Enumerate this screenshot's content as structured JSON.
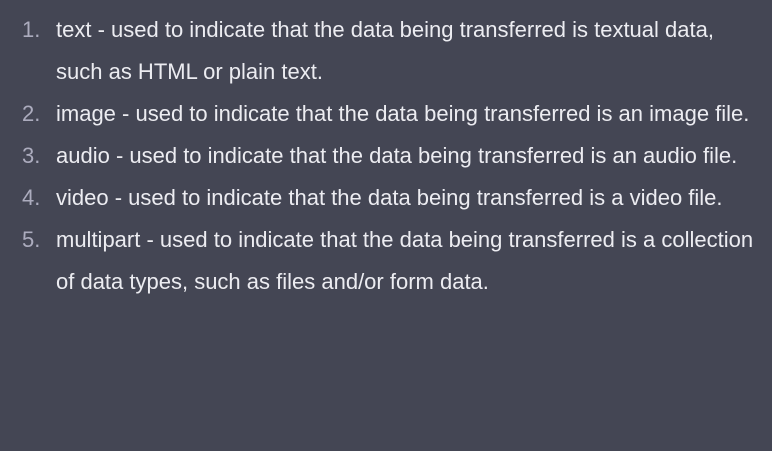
{
  "list": {
    "items": [
      {
        "number": "1.",
        "text": "text - used to indicate that the data being transferred is textual data, such as HTML or plain text."
      },
      {
        "number": "2.",
        "text": "image - used to indicate that the data being transferred is an image file."
      },
      {
        "number": "3.",
        "text": "audio - used to indicate that the data being transferred is an audio file."
      },
      {
        "number": "4.",
        "text": "video - used to indicate that the data being transferred is a video file."
      },
      {
        "number": "5.",
        "text": "multipart - used to indicate that the data being transferred is a collection of data types, such as files and/or form data."
      }
    ]
  }
}
